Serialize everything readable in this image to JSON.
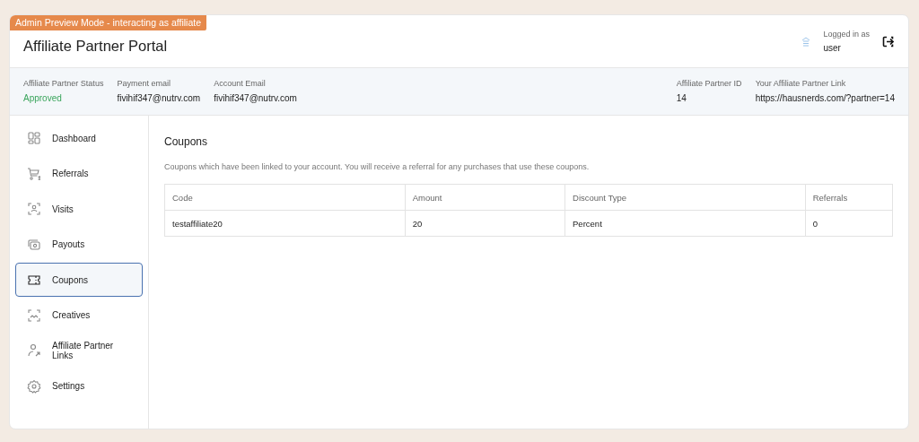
{
  "badge": "Admin Preview Mode - interacting as affiliate",
  "header": {
    "title": "Affiliate Partner Portal",
    "login_label": "Logged in as",
    "user": "user"
  },
  "info": [
    {
      "label": "Affiliate Partner Status",
      "value": "Approved",
      "kind": "status"
    },
    {
      "label": "Payment email",
      "value": "fivihif347@nutrv.com",
      "kind": "text"
    },
    {
      "label": "Account Email",
      "value": "fivihif347@nutrv.com",
      "kind": "text"
    },
    {
      "label": "Affiliate Partner ID",
      "value": "14",
      "kind": "text"
    },
    {
      "label": "Your Affiliate Partner Link",
      "value": "https://hausnerds.com/?partner=14",
      "kind": "text"
    }
  ],
  "sidebar": {
    "items": [
      {
        "label": "Dashboard",
        "selected": false
      },
      {
        "label": "Referrals",
        "selected": false
      },
      {
        "label": "Visits",
        "selected": false
      },
      {
        "label": "Payouts",
        "selected": false
      },
      {
        "label": "Coupons",
        "selected": true
      },
      {
        "label": "Creatives",
        "selected": false
      },
      {
        "label": "Affiliate Partner Links",
        "selected": false
      },
      {
        "label": "Settings",
        "selected": false
      }
    ]
  },
  "content": {
    "title": "Coupons",
    "description": "Coupons which have been linked to your account. You will receive a referral for any purchases that use these coupons.",
    "table": {
      "columns": [
        "Code",
        "Amount",
        "Discount Type",
        "Referrals"
      ],
      "rows": [
        [
          "testaffiliate20",
          "20",
          "Percent",
          "0"
        ]
      ]
    }
  }
}
